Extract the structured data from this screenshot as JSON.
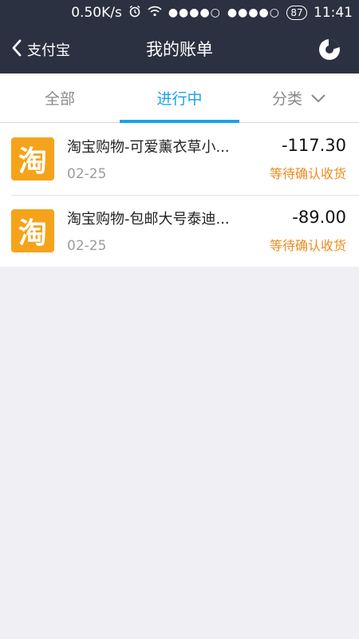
{
  "status_bar": {
    "speed": "0.50K/s",
    "signal": "●●●●○",
    "battery": "87",
    "time": "11:41"
  },
  "nav": {
    "back_label": "支付宝",
    "title": "我的账单"
  },
  "tabs": [
    {
      "label": "全部"
    },
    {
      "label": "进行中"
    },
    {
      "label": "分类"
    }
  ],
  "bills": [
    {
      "icon_text": "淘",
      "title": "淘宝购物-可爱薰衣草小...",
      "date": "02-25",
      "amount": "-117.30",
      "status": "等待确认收货"
    },
    {
      "icon_text": "淘",
      "title": "淘宝购物-包邮大号泰迪...",
      "date": "02-25",
      "amount": "-89.00",
      "status": "等待确认收货"
    }
  ],
  "colors": {
    "header_bg": "#2c3141",
    "accent": "#1aa3e8",
    "status_orange": "#f08a1c",
    "taobao_orange": "#f5a31a"
  },
  "icons": [
    "alarm-icon",
    "wifi-icon",
    "back-chevron-icon",
    "pie-chart-icon",
    "chevron-down-icon",
    "taobao-icon"
  ]
}
